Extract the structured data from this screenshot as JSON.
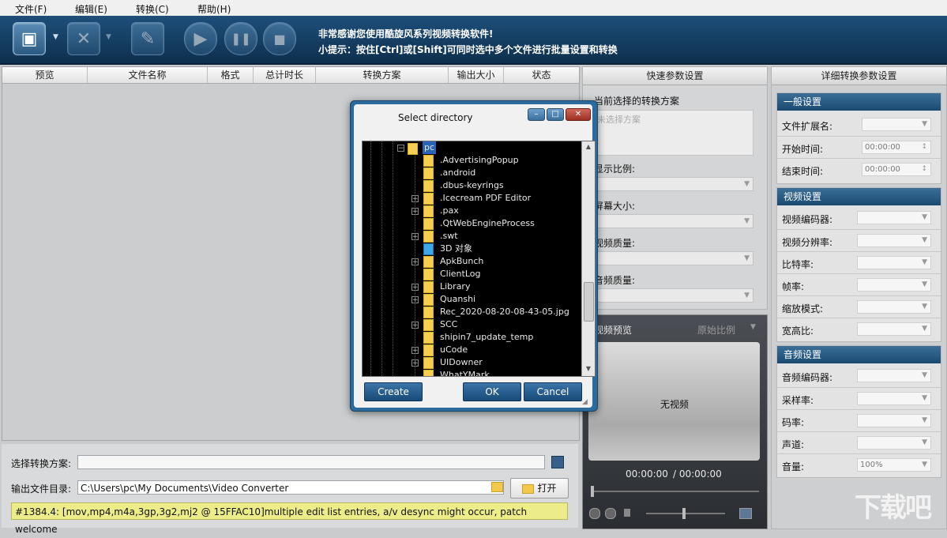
{
  "menu": [
    "文件(F)",
    "编辑(E)",
    "转换(C)",
    "帮助(H)"
  ],
  "toolbar": {
    "tip_line1": "非常感谢您使用酷旋风系列视频转换软件!",
    "tip_line2": "小提示：按住[Ctrl]或[Shift]可同时选中多个文件进行批量设置和转换",
    "drop_glyph": "▼",
    "icons": {
      "add": "▣",
      "remove": "✕",
      "edit": "✎",
      "play": "▶",
      "pause": "❚❚",
      "stop": "■"
    }
  },
  "filelist": {
    "columns": [
      "预览",
      "文件名称",
      "格式",
      "总计时长",
      "转换方案",
      "输出大小",
      "状态"
    ]
  },
  "bottom": {
    "scheme_label": "选择转换方案:",
    "scheme_value": "",
    "output_label": "输出文件目录:",
    "output_value": "C:\\Users\\pc\\My Documents\\Video Converter",
    "open_label": "打开",
    "status_text": "#1384.4: [mov,mp4,m4a,3gp,3g2,mj2 @ 15FFAC10]multiple edit list entries, a/v desync might occur, patch welcome"
  },
  "quick": {
    "title": "快速参数设置",
    "current_scheme_label": "当前选择的转换方案",
    "current_scheme_placeholder": "未选择方案",
    "aspect_label": "显示比例:",
    "screen_size_label": "屏幕大小:",
    "video_quality_label": "视频质量:",
    "audio_quality_label": "音频质量:"
  },
  "preview": {
    "title": "视频预览",
    "ratio": "原始比例",
    "no_video": "无视频",
    "time_current": "00:00:00",
    "time_total": "/ 00:00:00"
  },
  "detail": {
    "title": "详细转换参数设置",
    "general": {
      "heading": "一般设置",
      "ext_label": "文件扩展名:",
      "start_label": "开始时间:",
      "start_value": "00:00:00",
      "end_label": "结束时间:",
      "end_value": "00:00:00"
    },
    "video": {
      "heading": "视频设置",
      "rows": [
        "视频编码器:",
        "视频分辨率:",
        "比特率:",
        "帧率:",
        "缩放模式:",
        "宽高比:"
      ]
    },
    "audio": {
      "heading": "音频设置",
      "rows": [
        "音频编码器:",
        "采样率:",
        "码率:",
        "声道:",
        "音量:"
      ],
      "volume_value": "100%"
    }
  },
  "dialog": {
    "title": "Select directory",
    "root_node": "pc",
    "nodes": [
      ".AdvertisingPopup",
      ".android",
      ".dbus-keyrings",
      ".Icecream PDF Editor",
      ".pax",
      ".QtWebEngineProcess",
      ".swt",
      "3D 对象",
      "ApkBunch",
      "ClientLog",
      "Library",
      "Quanshi",
      "Rec_2020-08-20-08-43-05.jpg",
      "SCC",
      "shipin7_update_temp",
      "uCode",
      "UIDowner",
      "WhatYMark"
    ],
    "create_label": "Create",
    "ok_label": "OK",
    "cancel_label": "Cancel"
  },
  "watermark": "下载吧"
}
